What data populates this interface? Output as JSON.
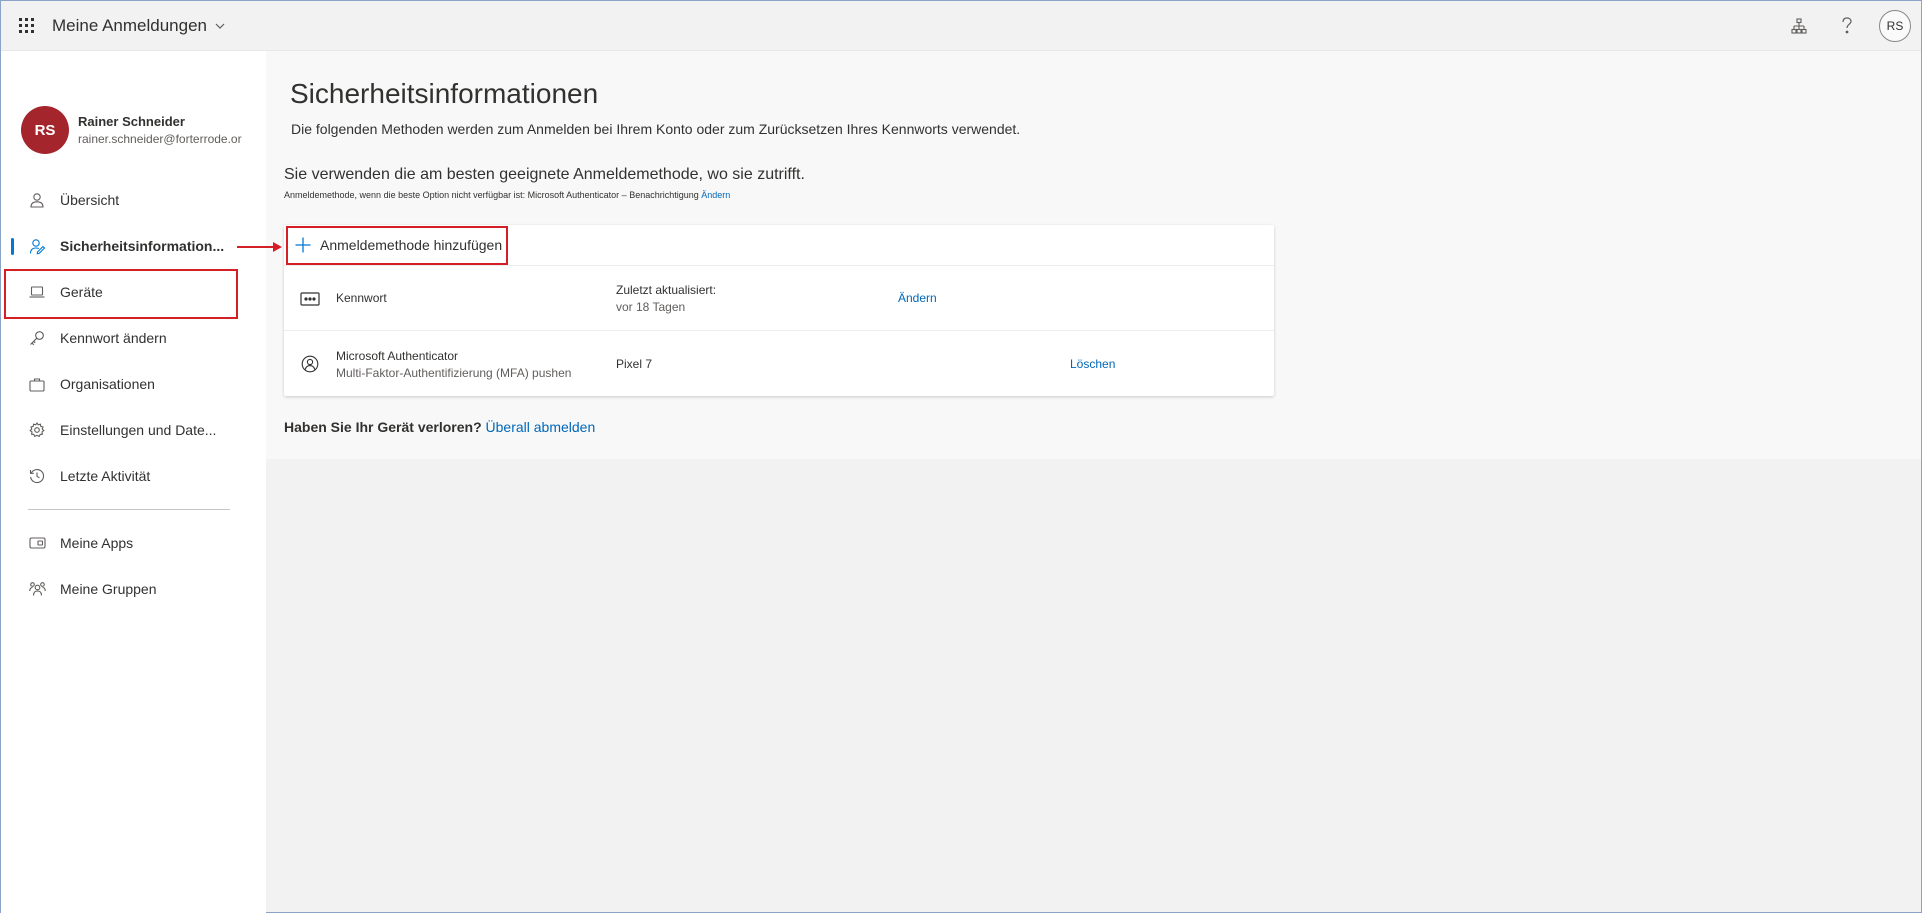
{
  "header": {
    "app_title": "Meine Anmeldungen",
    "avatar_initials": "RS",
    "icons": [
      "waffle-icon",
      "chevron-down-icon",
      "org-chart-icon",
      "help-icon"
    ]
  },
  "profile": {
    "initials": "RS",
    "name": "Rainer Schneider",
    "email": "rainer.schneider@forterrode.or",
    "avatar_color": "#a4262c"
  },
  "sidebar": {
    "items": [
      {
        "label": "Übersicht",
        "icon": "person-icon"
      },
      {
        "label": "Sicherheitsinformation...",
        "icon": "security-info-icon",
        "active": true
      },
      {
        "label": "Geräte",
        "icon": "laptop-icon"
      },
      {
        "label": "Kennwort ändern",
        "icon": "key-icon"
      },
      {
        "label": "Organisationen",
        "icon": "briefcase-icon"
      },
      {
        "label": "Einstellungen und Date...",
        "icon": "settings-icon"
      },
      {
        "label": "Letzte Aktivität",
        "icon": "history-icon"
      },
      {
        "label": "Meine Apps",
        "icon": "apps-icon"
      },
      {
        "label": "Meine Gruppen",
        "icon": "groups-icon"
      }
    ]
  },
  "main": {
    "title": "Sicherheitsinformationen",
    "subtitle": "Die folgenden Methoden werden zum Anmelden bei Ihrem Konto oder zum Zurücksetzen Ihres Kennworts verwendet.",
    "default_method_text": "Sie verwenden die am besten geeignete Anmeldemethode, wo sie zutrifft.",
    "fallback_text": "Anmeldemethode, wenn die beste Option nicht verfügbar ist: Microsoft Authenticator – Benachrichtigung",
    "fallback_link": "Ändern",
    "add_method_label": "Anmeldemethode hinzufügen",
    "methods": [
      {
        "name": "Kennwort",
        "detail_label": "Zuletzt aktualisiert:",
        "detail_value": "vor 18 Tagen",
        "action": "Ändern",
        "icon": "password-icon"
      },
      {
        "name": "Microsoft Authenticator",
        "sub": "Multi-Faktor-Authentifizierung (MFA) pushen",
        "detail_value": "Pixel 7",
        "action": "Löschen",
        "icon": "authenticator-icon"
      }
    ],
    "lost_device_text": "Haben Sie Ihr Gerät verloren?",
    "lost_device_link": "Überall abmelden"
  },
  "annotation_color": "#d41f26",
  "accent_color": "#0078d4",
  "link_color": "#0067b8"
}
